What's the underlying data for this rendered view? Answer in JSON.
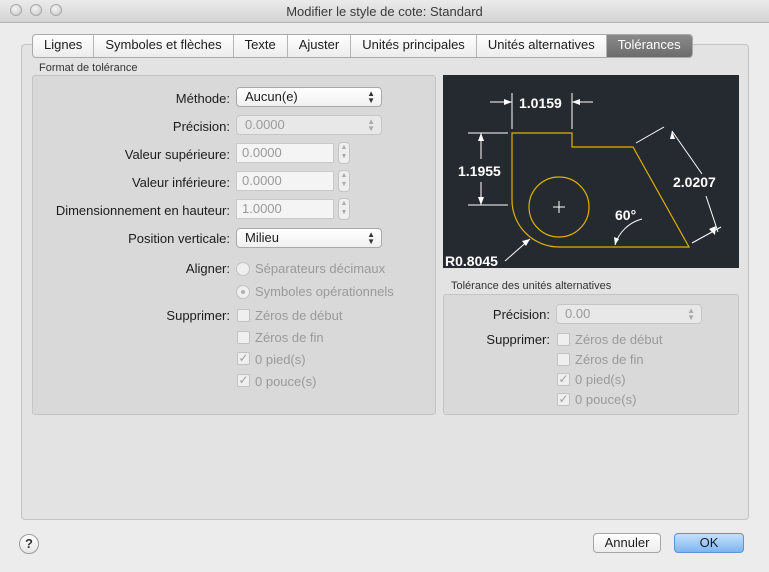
{
  "window": {
    "title": "Modifier le style de cote: Standard"
  },
  "tabs": [
    "Lignes",
    "Symboles et flèches",
    "Texte",
    "Ajuster",
    "Unités principales",
    "Unités alternatives",
    "Tolérances"
  ],
  "format": {
    "group_label": "Format de tolérance",
    "methode_label": "Méthode:",
    "methode_value": "Aucun(e)",
    "precision_label": "Précision:",
    "precision_value": "0.0000",
    "sup_label": "Valeur supérieure:",
    "sup_value": "0.0000",
    "inf_label": "Valeur inférieure:",
    "inf_value": "0.0000",
    "hauteur_label": "Dimensionnement en hauteur:",
    "hauteur_value": "1.0000",
    "position_label": "Position verticale:",
    "position_value": "Milieu",
    "aligner_label": "Aligner:",
    "aligner_opt1": "Séparateurs décimaux",
    "aligner_opt2": "Symboles opérationnels",
    "supprimer_label": "Supprimer:",
    "zeros_debut": "Zéros de début",
    "zeros_fin": "Zéros de fin",
    "pied": "0 pied(s)",
    "pouce": "0 pouce(s)"
  },
  "preview": {
    "dim_top": "1.0159",
    "dim_left": "1.1955",
    "dim_right": "2.0207",
    "angle": "60°",
    "radius": "R0.8045"
  },
  "alt": {
    "group_label": "Tolérance des unités alternatives",
    "precision_label": "Précision:",
    "precision_value": "0.00",
    "supprimer_label": "Supprimer:",
    "zeros_debut": "Zéros de début",
    "zeros_fin": "Zéros de fin",
    "pied": "0 pied(s)",
    "pouce": "0 pouce(s)"
  },
  "buttons": {
    "help": "?",
    "cancel": "Annuler",
    "ok": "OK"
  }
}
